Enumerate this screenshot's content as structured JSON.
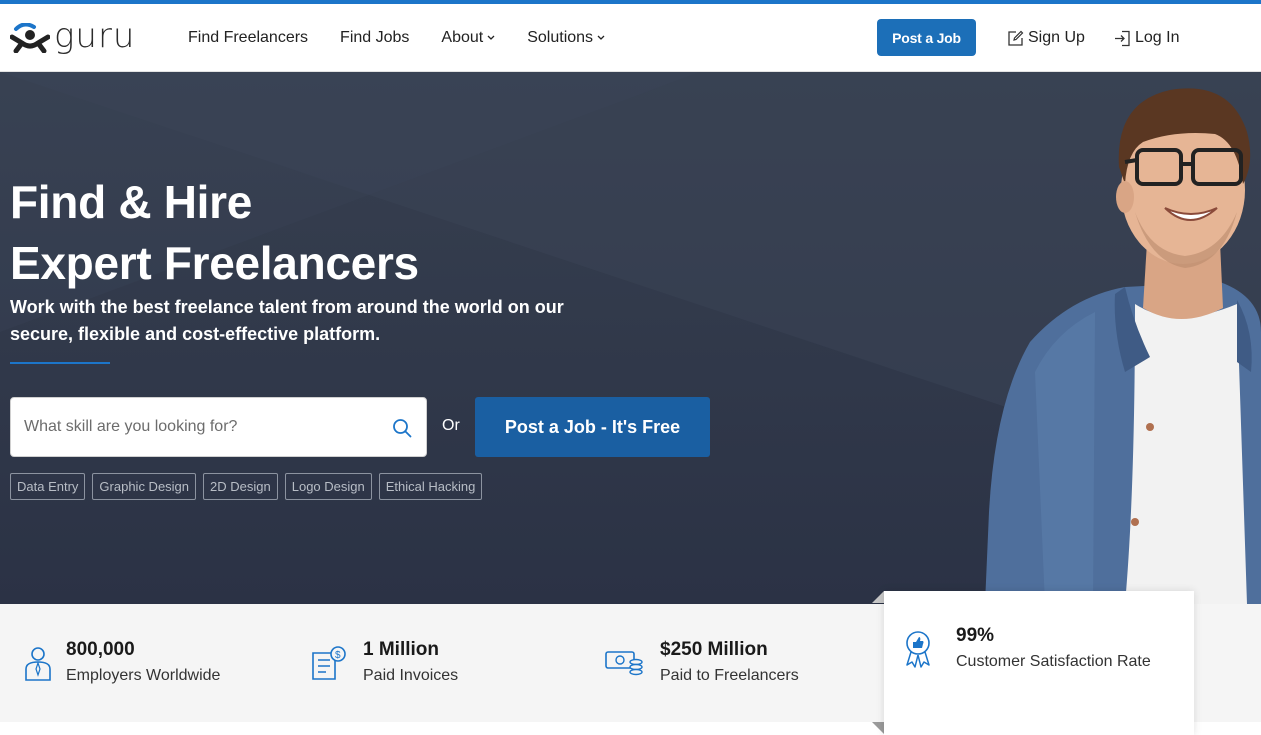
{
  "brand": {
    "logo_text": "guru",
    "accent": "#1c75c9",
    "button_blue": "#1c6fb8"
  },
  "nav": {
    "items": [
      {
        "label": "Find Freelancers",
        "dropdown": false
      },
      {
        "label": "Find Jobs",
        "dropdown": false
      },
      {
        "label": "About",
        "dropdown": true
      },
      {
        "label": "Solutions",
        "dropdown": true
      }
    ],
    "post_job": "Post a Job",
    "sign_up": "Sign Up",
    "log_in": "Log In"
  },
  "hero": {
    "title_line1": "Find & Hire",
    "title_line2": "Expert Freelancers",
    "subtitle": "Work with the best freelance talent from around the world on our secure, flexible and cost-effective platform.",
    "search_placeholder": "What skill are you looking for?",
    "or_text": "Or",
    "cta": "Post a Job - It's Free",
    "tags": [
      "Data Entry",
      "Graphic Design",
      "2D Design",
      "Logo Design",
      "Ethical Hacking"
    ]
  },
  "stats": [
    {
      "icon": "employer-icon",
      "value": "800,000",
      "label": "Employers Worldwide"
    },
    {
      "icon": "invoice-icon",
      "value": "1 Million",
      "label": "Paid Invoices"
    },
    {
      "icon": "money-icon",
      "value": "$250 Million",
      "label": "Paid to Freelancers"
    },
    {
      "icon": "award-ribbon-icon",
      "value": "99%",
      "label": "Customer Satisfaction Rate"
    }
  ]
}
